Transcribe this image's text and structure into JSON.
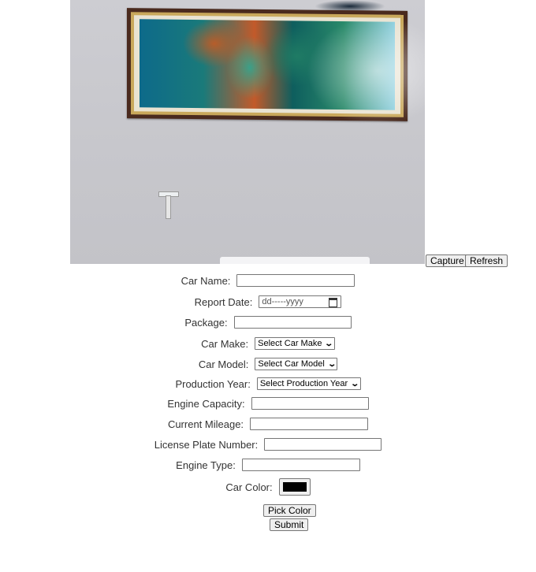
{
  "camera": {
    "capture_label": "Capture",
    "refresh_label": "Refresh"
  },
  "form": {
    "car_name": {
      "label": "Car Name:",
      "value": ""
    },
    "report_date": {
      "label": "Report Date:",
      "placeholder": "dd-----yyyy"
    },
    "package": {
      "label": "Package:",
      "value": ""
    },
    "car_make": {
      "label": "Car Make:",
      "selected": "Select Car Make"
    },
    "car_model": {
      "label": "Car Model:",
      "selected": "Select Car Model"
    },
    "production_year": {
      "label": "Production Year:",
      "selected": "Select Production Year"
    },
    "engine_capacity": {
      "label": "Engine Capacity:",
      "value": ""
    },
    "current_mileage": {
      "label": "Current Mileage:",
      "value": ""
    },
    "license_plate": {
      "label": "License Plate Number:",
      "value": ""
    },
    "engine_type": {
      "label": "Engine Type:",
      "value": ""
    },
    "car_color": {
      "label": "Car Color:",
      "value": "#000000"
    },
    "pick_color_label": "Pick Color",
    "submit_label": "Submit"
  }
}
